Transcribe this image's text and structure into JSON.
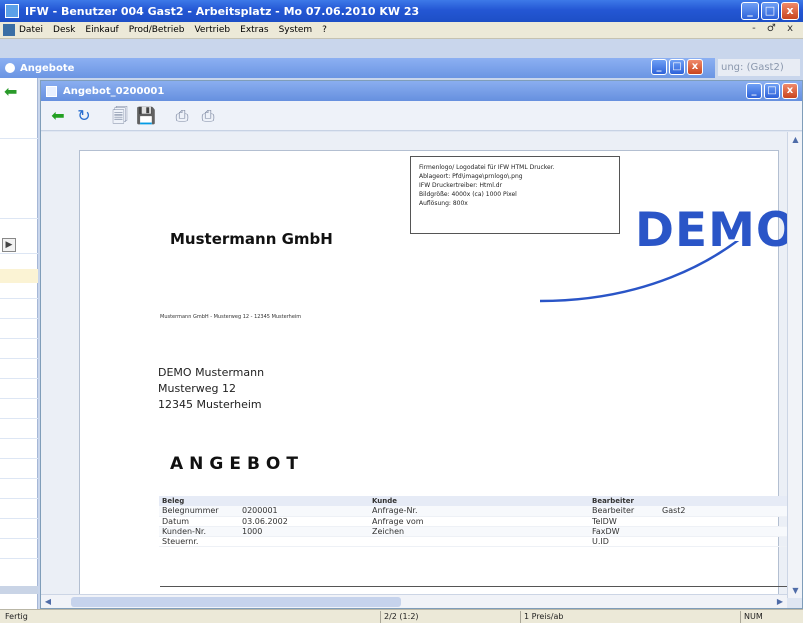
{
  "app": {
    "title": "IFW - Benutzer 004 Gast2 - Arbeitsplatz - Mo 07.06.2010 KW 23",
    "window_buttons": {
      "minimize": "_",
      "maximize": "□",
      "close": "x"
    }
  },
  "menu": {
    "items": [
      "Datei",
      "Desk",
      "Einkauf",
      "Prod/Betrieb",
      "Vertrieb",
      "Extras",
      "System",
      "?"
    ],
    "mdi_controls": "- ♂ x"
  },
  "angebote_window": {
    "title": "Angebote",
    "background_field": "ung: (Gast2)"
  },
  "angebot_window": {
    "title": "Angebot_0200001"
  },
  "document": {
    "logo_info_lines": [
      "Firmenlogo/ Logodatei für IFW HTML Drucker.",
      "Ablageort: Pfd\\image\\prnlogo\\.png",
      "IFW Druckertreiber: Html.dr",
      "Bildgröße: 4000x (ca) 1000 Pixel",
      "Auflösung: 800x"
    ],
    "logo_text": "DEMO",
    "company": "Mustermann GmbH",
    "sender_line": "Mustermann GmbH - Musterweg 12 - 12345 Musterheim",
    "address_lines": [
      "DEMO Mustermann",
      "Musterweg 12",
      "12345 Musterheim"
    ],
    "heading": "ANGEBOT",
    "info_headers": [
      "Beleg",
      "",
      "Kunde",
      "",
      "Bearbeiter",
      ""
    ],
    "info_rows": [
      [
        "Belegnummer",
        "0200001",
        "Anfrage-Nr.",
        "",
        "Bearbeiter",
        "Gast2"
      ],
      [
        "Datum",
        "03.06.2002",
        "Anfrage vom",
        "",
        "TelDW",
        ""
      ],
      [
        "Kunden-Nr.",
        "1000",
        "Zeichen",
        "",
        "FaxDW",
        ""
      ],
      [
        "Steuernr.",
        "",
        "",
        "",
        "U.ID",
        ""
      ]
    ]
  },
  "status": {
    "left": "Fertig",
    "middle": "2/2 (1:2)",
    "right": "1 Preis/ab",
    "num": "NUM"
  },
  "colors": {
    "title_blue": "#2457d4",
    "demo_blue": "#2a55c7",
    "menubar": "#ece9d8"
  }
}
